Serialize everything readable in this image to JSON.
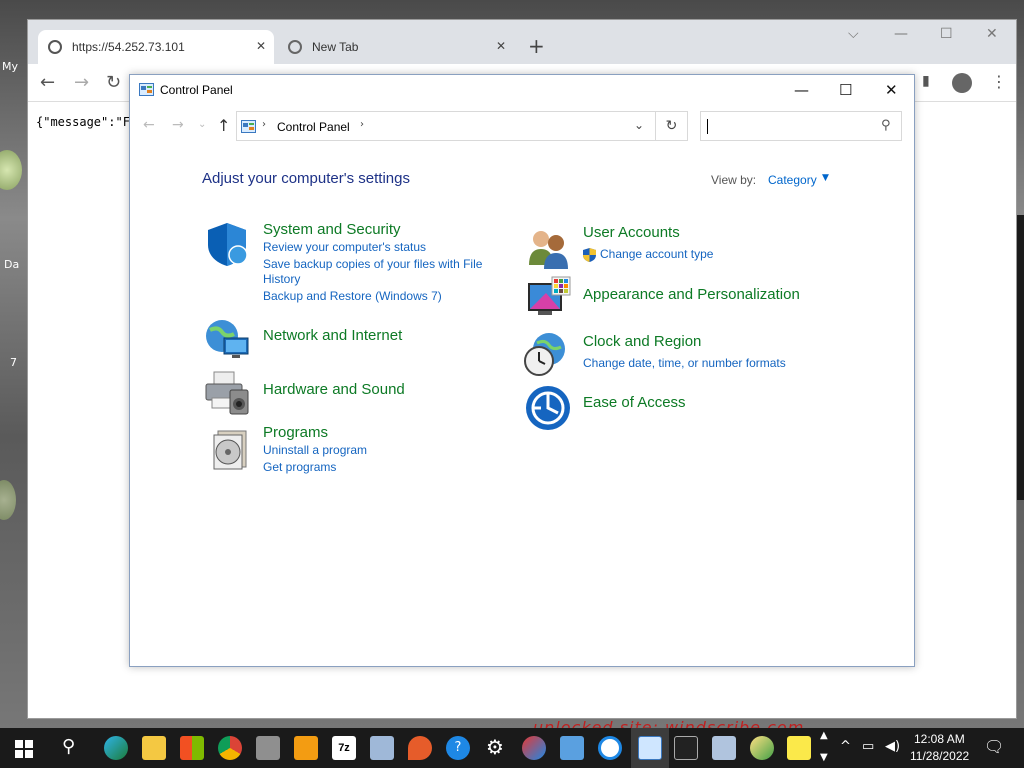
{
  "desktop": {
    "labels": [
      "My",
      "Da",
      "7"
    ],
    "watermark": "unlocked site: windscribe.com"
  },
  "browser": {
    "tabs": [
      {
        "label": "https://54.252.73.101"
      },
      {
        "label": "New Tab"
      }
    ],
    "new_tab_glyph": "+",
    "page_text": "{\"message\":\"F"
  },
  "control_panel": {
    "title": "Control Panel",
    "address": "Control Panel",
    "search_placeholder": "",
    "heading": "Adjust your computer's settings",
    "view_by_label": "View by:",
    "view_by_value": "Category",
    "categories_left": [
      {
        "title": "System and Security",
        "icon": "shield-icon",
        "links": [
          "Review your computer's status",
          "Save backup copies of your files with File",
          "History",
          "Backup and Restore (Windows 7)"
        ]
      },
      {
        "title": "Network and Internet",
        "icon": "globe-network-icon",
        "links": []
      },
      {
        "title": "Hardware and Sound",
        "icon": "printer-speaker-icon",
        "links": []
      },
      {
        "title": "Programs",
        "icon": "programs-disc-icon",
        "links": [
          "Uninstall a program",
          "Get programs"
        ]
      }
    ],
    "categories_right": [
      {
        "title": "User Accounts",
        "icon": "users-icon",
        "links": [
          "Change account type"
        ]
      },
      {
        "title": "Appearance and Personalization",
        "icon": "monitor-palette-icon",
        "links": []
      },
      {
        "title": "Clock and Region",
        "icon": "clock-globe-icon",
        "links": [
          "Change date, time, or number formats"
        ]
      },
      {
        "title": "Ease of Access",
        "icon": "ease-of-access-icon",
        "links": []
      }
    ]
  },
  "taskbar": {
    "time": "12:08 AM",
    "date": "11/28/2022",
    "apps": [
      "windows-start",
      "search",
      "edge",
      "file-explorer",
      "store",
      "chrome",
      "calculator",
      "media-player",
      "7zip",
      "image-viewer",
      "maps",
      "help",
      "settings",
      "paint",
      "remote-desktop",
      "internet-explorer",
      "control-panel",
      "terminal",
      "network-manager",
      "tools",
      "sticky-notes"
    ]
  },
  "colors": {
    "category_title": "#0d7a25",
    "link": "#1565c0",
    "heading": "#1e3287"
  }
}
